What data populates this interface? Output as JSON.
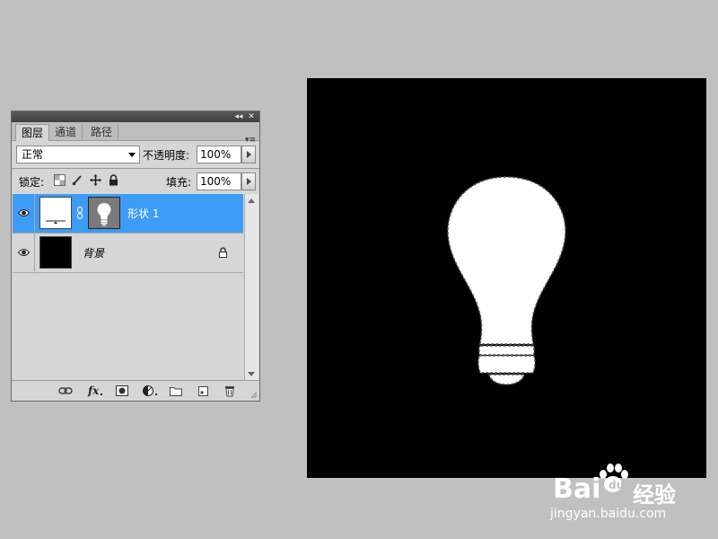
{
  "panel": {
    "tabs": [
      {
        "label": "图层",
        "active": true
      },
      {
        "label": "通道",
        "active": false
      },
      {
        "label": "路径",
        "active": false
      }
    ],
    "blend_mode": "正常",
    "opacity_label": "不透明度:",
    "opacity_value": "100%",
    "lock_label": "锁定:",
    "fill_label": "填充:",
    "fill_value": "100%",
    "layers": [
      {
        "name": "形状 1",
        "selected": true,
        "visible": true
      },
      {
        "name": "背景",
        "selected": false,
        "visible": true,
        "locked": true
      }
    ],
    "bottom_icons": [
      "link-icon",
      "fx-icon",
      "mask-icon",
      "adjustment-icon",
      "folder-icon",
      "new-layer-icon",
      "trash-icon"
    ]
  },
  "canvas": {
    "background": "#000000",
    "shape": "lightbulb",
    "shape_color": "#ffffff",
    "selection": "marching-ants"
  },
  "watermark": {
    "brand": "Bai",
    "brand_suffix": "经验",
    "url": "jingyan.baidu.com"
  },
  "colors": {
    "workspace": "#c0c0c0",
    "selected_layer": "#3d9cf5",
    "panel": "#d6d6d6"
  }
}
